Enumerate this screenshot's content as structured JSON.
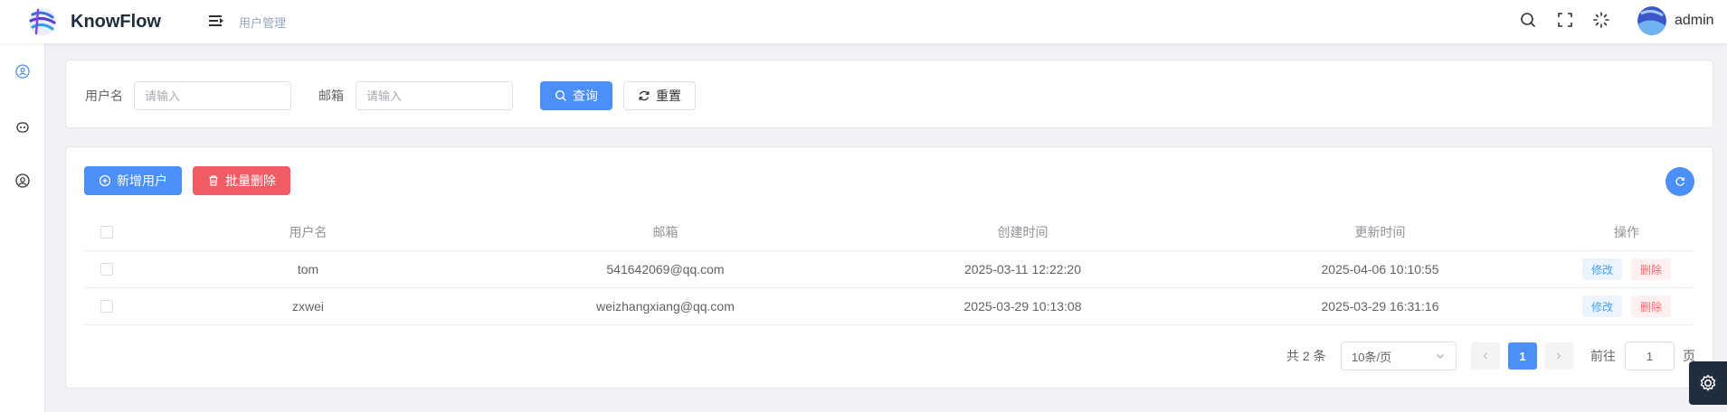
{
  "header": {
    "brand": "KnowFlow",
    "breadcrumb": "用户管理",
    "username": "admin",
    "icons": [
      "search-icon",
      "fullscreen-icon",
      "theme-icon"
    ]
  },
  "sidebar": {
    "items": [
      "user-icon",
      "robot-icon",
      "account-icon"
    ]
  },
  "search": {
    "username_label": "用户名",
    "username_placeholder": "请输入",
    "email_label": "邮箱",
    "email_placeholder": "请输入",
    "query_label": "查询",
    "reset_label": "重置"
  },
  "toolbar": {
    "add_label": "新增用户",
    "batch_delete_label": "批量删除"
  },
  "table": {
    "columns": [
      "用户名",
      "邮箱",
      "创建时间",
      "更新时间",
      "操作"
    ],
    "rows": [
      {
        "username": "tom",
        "email": "541642069@qq.com",
        "created": "2025-03-11 12:22:20",
        "updated": "2025-04-06 10:10:55"
      },
      {
        "username": "zxwei",
        "email": "weizhangxiang@qq.com",
        "created": "2025-03-29 10:13:08",
        "updated": "2025-03-29 16:31:16"
      }
    ],
    "edit_label": "修改",
    "delete_label": "删除"
  },
  "pagination": {
    "total": "共 2 条",
    "page_size": "10条/页",
    "current_page": "1",
    "goto_label": "前往",
    "goto_value": "1",
    "page_suffix": "页"
  },
  "colors": {
    "primary": "#4b8ff8",
    "danger": "#f15c62",
    "dark": "#1f2d3d"
  }
}
